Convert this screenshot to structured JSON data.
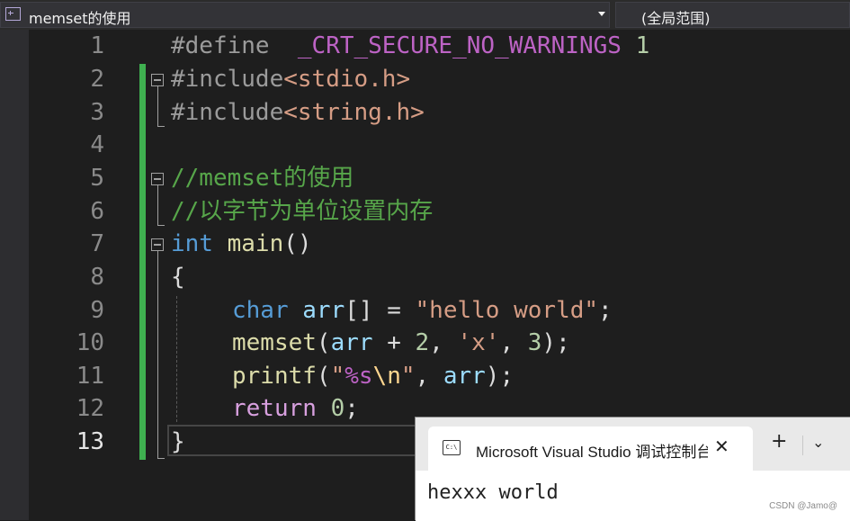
{
  "nav": {
    "file_scope": "memset的使用",
    "symbol_scope": "(全局范围)"
  },
  "editor": {
    "lines": [
      {
        "n": "1"
      },
      {
        "n": "2"
      },
      {
        "n": "3"
      },
      {
        "n": "4"
      },
      {
        "n": "5"
      },
      {
        "n": "6"
      },
      {
        "n": "7"
      },
      {
        "n": "8"
      },
      {
        "n": "9"
      },
      {
        "n": "10"
      },
      {
        "n": "11"
      },
      {
        "n": "12"
      },
      {
        "n": "13"
      }
    ],
    "code": {
      "l1_kw": "#define",
      "l1_macro": "_CRT_SECURE_NO_WARNINGS",
      "l1_val": "1",
      "l2_kw": "#include",
      "l2_hdr": "<stdio.h>",
      "l3_kw": "#include",
      "l3_hdr": "<string.h>",
      "l5_com": "//memset的使用",
      "l6_com": "//以字节为单位设置内存",
      "l7_type": "int",
      "l7_fn": "main",
      "l7_paren": "()",
      "l8": "{",
      "l9_type": "char",
      "l9_var": "arr",
      "l9_mid": "[] = ",
      "l9_str": "\"hello world\"",
      "l9_end": ";",
      "l10_fn": "memset",
      "l10_p1": "(",
      "l10_var": "arr",
      "l10_op": " + ",
      "l10_n1": "2",
      "l10_c1": ", ",
      "l10_chr": "'x'",
      "l10_c2": ", ",
      "l10_n2": "3",
      "l10_end": ");",
      "l11_fn": "printf",
      "l11_p1": "(",
      "l11_q1": "\"",
      "l11_fmt": "%s",
      "l11_esc": "\\n",
      "l11_q2": "\"",
      "l11_c": ", ",
      "l11_var": "arr",
      "l11_end": ");",
      "l12_kw": "return",
      "l12_num": "0",
      "l12_end": ";",
      "l13": "}"
    },
    "active_line": "13"
  },
  "console": {
    "icon": "C:\\",
    "title": "Microsoft Visual Studio 调试控制台",
    "close": "✕",
    "new_tab": "+",
    "dropdown": "⌄",
    "output": "hexxx world"
  },
  "watermark": "CSDN @Jamo@",
  "colors": {
    "background": "#1e1e1e",
    "change_bar": "#3fb050",
    "keyword": "#569cd6",
    "string": "#d69d85",
    "comment": "#57a64a",
    "function": "#dcdcaa",
    "variable": "#9cdcfe",
    "macro": "#bd63c5",
    "control": "#d8a0df"
  }
}
